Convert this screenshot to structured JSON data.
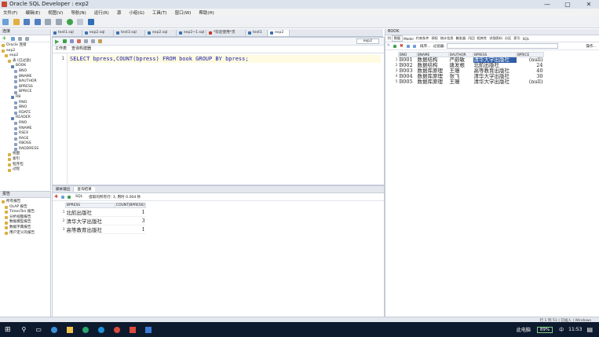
{
  "window": {
    "title": "Oracle SQL Developer : exp2",
    "controls": [
      "—",
      "▢",
      "✕"
    ]
  },
  "menu": [
    "文件(F)",
    "编辑(E)",
    "视图(V)",
    "导航(N)",
    "运行(R)",
    "源",
    "小组(G)",
    "工具(T)",
    "窗口(W)",
    "帮助(H)"
  ],
  "connections": {
    "header": "连接",
    "tree": [
      {
        "label": "Oracle 连接",
        "level": 0
      },
      {
        "label": "exp2",
        "level": 0
      },
      {
        "label": "exp2",
        "level": 1
      },
      {
        "label": "表 (已过滤)",
        "level": 2
      },
      {
        "label": "BOOK",
        "level": 3
      },
      {
        "label": "BNO",
        "level": 4
      },
      {
        "label": "BNAME",
        "level": 4
      },
      {
        "label": "BAUTHOR",
        "level": 4
      },
      {
        "label": "BPRESS",
        "level": 4
      },
      {
        "label": "BPRICE",
        "level": 4
      },
      {
        "label": "RB",
        "level": 3
      },
      {
        "label": "RNO",
        "level": 4
      },
      {
        "label": "BNO",
        "level": 4
      },
      {
        "label": "RDATE",
        "level": 4
      },
      {
        "label": "READER",
        "level": 3
      },
      {
        "label": "RNO",
        "level": 4
      },
      {
        "label": "RNAME",
        "level": 4
      },
      {
        "label": "RSEX",
        "level": 4
      },
      {
        "label": "RAGE",
        "level": 4
      },
      {
        "label": "RBOSS",
        "level": 4
      },
      {
        "label": "RADDRESS",
        "level": 4
      },
      {
        "label": "视图",
        "level": 2
      },
      {
        "label": "索引",
        "level": 2
      },
      {
        "label": "程序包",
        "level": 2
      },
      {
        "label": "过程",
        "level": 2
      }
    ]
  },
  "reports": {
    "header": "报告",
    "items": [
      "所有报告",
      "OLAP 报告",
      "TimesTen 报告",
      "分析视图报告",
      "数据模型报告",
      "数据字典报告",
      "用户定义的报告"
    ]
  },
  "tabs": [
    "test1.sql",
    "exp2.sql",
    "test3.sql",
    "exp2.sql",
    "exp2~1.sql",
    "*欢迎使用*页",
    "test1",
    "exp2"
  ],
  "editor": {
    "subtabs": [
      "工作表",
      "查询构建器"
    ],
    "connection": "exp2",
    "line_number": "1",
    "sql": "SELECT bpress,COUNT(bpress) FROM book GROUP BY bpress;"
  },
  "results": {
    "tabs": [
      "脚本输出",
      "查询结果"
    ],
    "toolbar_text": "SQL",
    "status": "提取的所有行: 3, 用时 0.004 秒",
    "columns": [
      "BPRESS",
      "COUNT(BPRESS)"
    ],
    "rows": [
      {
        "n": "1",
        "cells": [
          "北航出版社",
          "1"
        ]
      },
      {
        "n": "2",
        "cells": [
          "清华大学出版社",
          "3"
        ]
      },
      {
        "n": "3",
        "cells": [
          "高等教育出版社",
          "1"
        ]
      }
    ]
  },
  "book": {
    "title": "BOOK",
    "subtabs": [
      "列",
      "数据",
      "Model",
      "约束条件",
      "授权",
      "统计信息",
      "触发器",
      "闪回",
      "相关性",
      "详细资料",
      "分区",
      "索引",
      "SQL"
    ],
    "action": "操作...",
    "filter_label": "过滤器:",
    "sort_label": "排序...",
    "columns": [
      "BNO",
      "BNAME",
      "BAUTHOR",
      "BPRESS",
      "BPRICE"
    ],
    "rows": [
      {
        "n": "1",
        "cells": [
          "B001",
          "数据结构",
          "严蔚敏",
          "清华大学出版社",
          "(null)"
        ]
      },
      {
        "n": "2",
        "cells": [
          "B002",
          "数据结构",
          "唐发根",
          "北航出版社",
          "24"
        ]
      },
      {
        "n": "3",
        "cells": [
          "B003",
          "数据库原理",
          "王珊",
          "高等教育出版社",
          "40"
        ]
      },
      {
        "n": "4",
        "cells": [
          "B004",
          "数据库原理",
          "张飞",
          "清华大学出版社",
          "30"
        ]
      },
      {
        "n": "5",
        "cells": [
          "B005",
          "数据库原理",
          "王珊",
          "清华大学出版社",
          "(null)"
        ]
      }
    ]
  },
  "statusbar": {
    "right": "行 1 列 51 | 已插入 | Windows"
  },
  "taskbar": {
    "system_text": "此电脑",
    "battery": "89%",
    "ime": "中",
    "time": "11:53"
  }
}
